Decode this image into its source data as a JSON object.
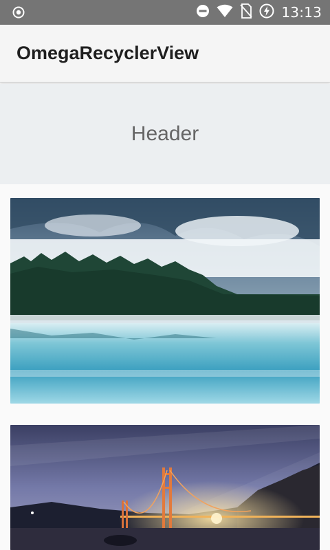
{
  "status_bar": {
    "time": "13:13",
    "icons": [
      "notification-icon",
      "do-not-disturb-icon",
      "wifi-icon",
      "no-sim-icon",
      "battery-charging-icon"
    ]
  },
  "app_bar": {
    "title": "OmegaRecyclerView"
  },
  "header": {
    "text": "Header"
  },
  "list": {
    "items": [
      {
        "image": "misty-lake-forest-photo"
      },
      {
        "image": "golden-gate-bridge-night-photo"
      }
    ]
  },
  "colors": {
    "status_bar": "#757575",
    "app_bar": "#f5f5f5",
    "header_bg": "#eceff1",
    "page_bg": "#fafafa"
  }
}
